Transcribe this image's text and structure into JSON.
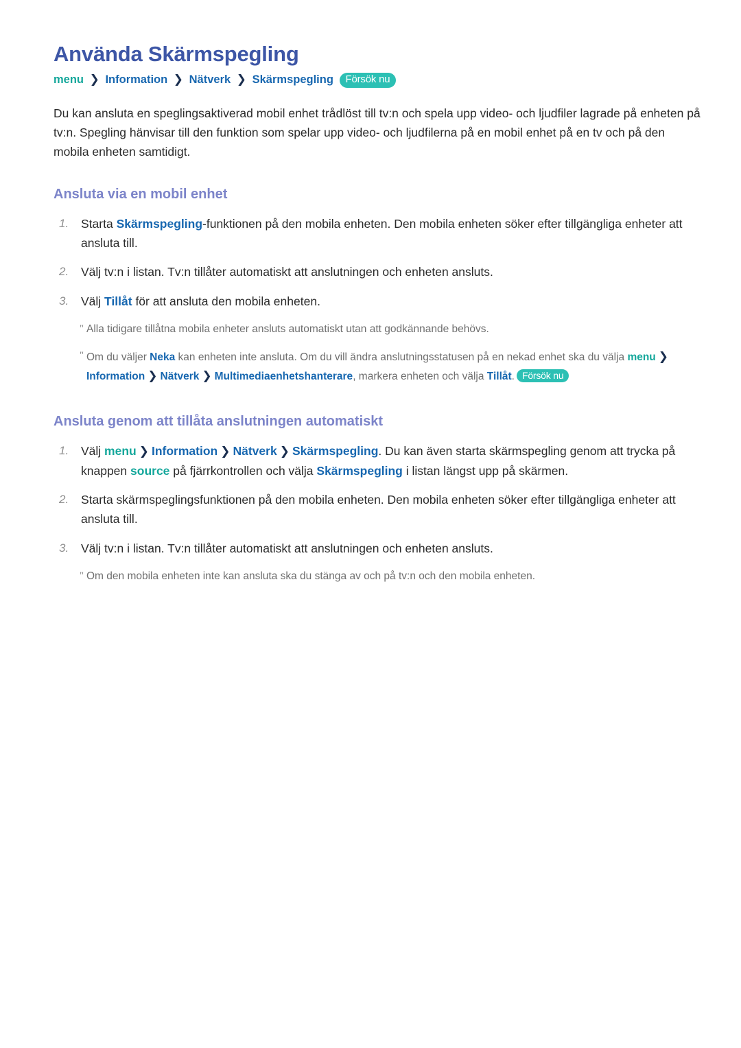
{
  "document": {
    "title": "Använda Skärmspegling",
    "language": "sv"
  },
  "breadcrumb": {
    "separator": "❯",
    "items": [
      {
        "label": "menu",
        "style": "teal"
      },
      {
        "label": "Information",
        "style": "blue"
      },
      {
        "label": "Nätverk",
        "style": "blue"
      },
      {
        "label": "Skärmspegling",
        "style": "blue"
      }
    ],
    "badge": "Försök nu"
  },
  "intro": "Du kan ansluta en speglingsaktiverad mobil enhet trådlöst till tv:n och spela upp video- och ljudfiler lagrade på enheten på tv:n. Spegling hänvisar till den funktion som spelar upp video- och ljudfilerna på en mobil enhet på en tv och på den mobila enheten samtidigt.",
  "sections": [
    {
      "heading": "Ansluta via en mobil enhet",
      "steps": [
        {
          "number": "1.",
          "parts": [
            {
              "t": "Starta ",
              "k": "plain"
            },
            {
              "t": "Skärmspegling",
              "k": "blue"
            },
            {
              "t": "-funktionen på den mobila enheten. Den mobila enheten söker efter tillgängliga enheter att ansluta till.",
              "k": "plain"
            }
          ]
        },
        {
          "number": "2.",
          "parts": [
            {
              "t": "Välj tv:n i listan. Tv:n tillåter automatiskt att anslutningen och enheten ansluts.",
              "k": "plain"
            }
          ]
        },
        {
          "number": "3.",
          "parts": [
            {
              "t": "Välj ",
              "k": "plain"
            },
            {
              "t": "Tillåt",
              "k": "blue"
            },
            {
              "t": " för att ansluta den mobila enheten.",
              "k": "plain"
            }
          ]
        }
      ],
      "notes": [
        {
          "marker": "\"",
          "parts": [
            {
              "t": "Alla tidigare tillåtna mobila enheter ansluts automatiskt utan att godkännande behövs.",
              "k": "plain"
            }
          ]
        },
        {
          "marker": "\"",
          "parts": [
            {
              "t": "Om du väljer ",
              "k": "plain"
            },
            {
              "t": "Neka",
              "k": "blue"
            },
            {
              "t": " kan enheten inte ansluta. Om du vill ändra anslutningsstatusen på en nekad enhet ska du välja ",
              "k": "plain"
            },
            {
              "t": "menu",
              "k": "teal"
            },
            {
              "t": "❯",
              "k": "sep"
            },
            {
              "t": "Information",
              "k": "blue"
            },
            {
              "t": "❯",
              "k": "sep"
            },
            {
              "t": "Nätverk",
              "k": "blue"
            },
            {
              "t": "❯",
              "k": "sep"
            },
            {
              "t": "Multimediaenhetshanterare",
              "k": "blue"
            },
            {
              "t": ", markera enheten och välja ",
              "k": "plain"
            },
            {
              "t": "Tillåt",
              "k": "blue"
            },
            {
              "t": ".",
              "k": "plain"
            },
            {
              "t": "Försök nu",
              "k": "badge"
            }
          ]
        }
      ]
    },
    {
      "heading": "Ansluta genom att tillåta anslutningen automatiskt",
      "steps": [
        {
          "number": "1.",
          "parts": [
            {
              "t": "Välj ",
              "k": "plain"
            },
            {
              "t": "menu",
              "k": "teal"
            },
            {
              "t": "❯",
              "k": "sep"
            },
            {
              "t": "Information",
              "k": "blue"
            },
            {
              "t": "❯",
              "k": "sep"
            },
            {
              "t": "Nätverk",
              "k": "blue"
            },
            {
              "t": "❯",
              "k": "sep"
            },
            {
              "t": "Skärmspegling",
              "k": "blue"
            },
            {
              "t": ". Du kan även starta skärmspegling genom att trycka på knappen ",
              "k": "plain"
            },
            {
              "t": "source",
              "k": "teal"
            },
            {
              "t": " på fjärrkontrollen och välja ",
              "k": "plain"
            },
            {
              "t": "Skärmspegling",
              "k": "blue"
            },
            {
              "t": " i listan längst upp på skärmen.",
              "k": "plain"
            }
          ]
        },
        {
          "number": "2.",
          "parts": [
            {
              "t": "Starta skärmspeglingsfunktionen på den mobila enheten. Den mobila enheten söker efter tillgängliga enheter att ansluta till.",
              "k": "plain"
            }
          ]
        },
        {
          "number": "3.",
          "parts": [
            {
              "t": "Välj tv:n i listan. Tv:n tillåter automatiskt att anslutningen och enheten ansluts.",
              "k": "plain"
            }
          ]
        }
      ],
      "notes": [
        {
          "marker": "\"",
          "parts": [
            {
              "t": "Om den mobila enheten inte kan ansluta ska du stänga av och på tv:n och den mobila enheten.",
              "k": "plain"
            }
          ]
        }
      ]
    }
  ],
  "colors": {
    "title_blue": "#3d56a6",
    "heading_purple": "#7c84c9",
    "link_blue": "#1767b0",
    "menu_teal": "#14a79b",
    "badge_teal": "#2cc0b4",
    "body_text": "#2b2b2b",
    "note_text": "#6e6e6e",
    "number_gray": "#8e8e8e"
  }
}
